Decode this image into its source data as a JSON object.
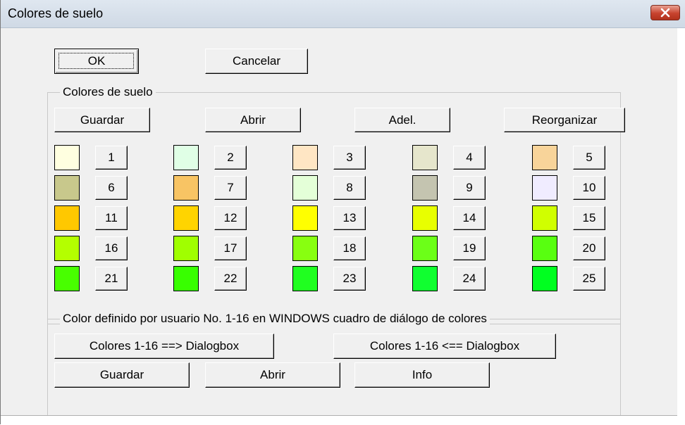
{
  "window": {
    "title": "Colores de suelo"
  },
  "top_buttons": {
    "ok": "OK",
    "cancel": "Cancelar"
  },
  "floor_group": {
    "title": "Colores de suelo",
    "save": "Guardar",
    "open": "Abrir",
    "adel": "Adel.",
    "reorganize": "Reorganizar",
    "colors": [
      {
        "n": "1",
        "color": "#ffffe0"
      },
      {
        "n": "2",
        "color": "#e0ffe6"
      },
      {
        "n": "3",
        "color": "#ffe6c4"
      },
      {
        "n": "4",
        "color": "#e6e6cc"
      },
      {
        "n": "5",
        "color": "#f8d49a"
      },
      {
        "n": "6",
        "color": "#c8c88c"
      },
      {
        "n": "7",
        "color": "#f8c464"
      },
      {
        "n": "8",
        "color": "#e4ffd8"
      },
      {
        "n": "9",
        "color": "#c4c4b0"
      },
      {
        "n": "10",
        "color": "#f0ecff"
      },
      {
        "n": "11",
        "color": "#ffc800"
      },
      {
        "n": "12",
        "color": "#ffd400"
      },
      {
        "n": "13",
        "color": "#ffff00"
      },
      {
        "n": "14",
        "color": "#e8ff00"
      },
      {
        "n": "15",
        "color": "#d0ff00"
      },
      {
        "n": "16",
        "color": "#b4ff00"
      },
      {
        "n": "17",
        "color": "#a0ff00"
      },
      {
        "n": "18",
        "color": "#88ff10"
      },
      {
        "n": "19",
        "color": "#6cff18"
      },
      {
        "n": "20",
        "color": "#58ff10"
      },
      {
        "n": "21",
        "color": "#48ff00"
      },
      {
        "n": "22",
        "color": "#38ff00"
      },
      {
        "n": "23",
        "color": "#20ff20"
      },
      {
        "n": "24",
        "color": "#10ff30"
      },
      {
        "n": "25",
        "color": "#00ff20"
      }
    ]
  },
  "user_group": {
    "title": "Color definido por usuario No. 1-16 en WINDOWS cuadro de diálogo de colores",
    "to_dialog": "Colores 1-16 ==> Dialogbox",
    "from_dialog": "Colores 1-16 <== Dialogbox",
    "save": "Guardar",
    "open": "Abrir",
    "info": "Info"
  }
}
